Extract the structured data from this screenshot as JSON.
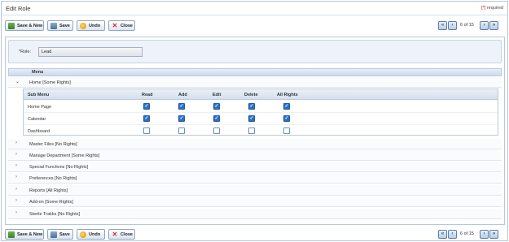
{
  "window": {
    "title": "Edit Role",
    "required_star": "[*]",
    "required_text": "required"
  },
  "toolbar": {
    "save_new": "Save & New",
    "save": "Save",
    "undo": "Undo",
    "close": "Close",
    "page_info": "6 of 15",
    "first": "«",
    "prev": "‹",
    "next": "›",
    "last": "»"
  },
  "role": {
    "label": "*Role:",
    "value": "Lead"
  },
  "menu": {
    "header": "Menu",
    "home_label": "Home  [Some Rights]",
    "sub_headers": [
      "Sub Menu",
      "Read",
      "Add",
      "Edit",
      "Delete",
      "All Rights"
    ],
    "sub_rows": [
      {
        "name": "Home Page",
        "checks": [
          true,
          true,
          true,
          true,
          true
        ]
      },
      {
        "name": "Calendar",
        "checks": [
          true,
          true,
          true,
          true,
          true
        ]
      },
      {
        "name": "Dashboard",
        "checks": [
          false,
          false,
          false,
          false,
          false
        ]
      }
    ],
    "items": [
      "Master Files  [No Rights]",
      "Manage Department  [Some Rights]",
      "Special Functions  [No Rights]",
      "Preferences  [No Rights]",
      "Reports  [All Rights]",
      "Add-on  [Some Rights]",
      "Sterile Trakks  [No Rights]"
    ]
  }
}
